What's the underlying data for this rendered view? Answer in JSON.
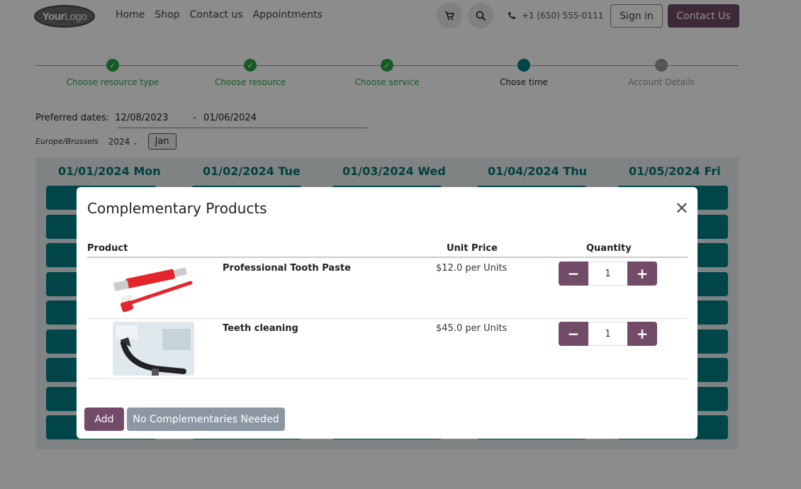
{
  "header": {
    "logo_text_bold": "Your",
    "logo_text": "Logo",
    "nav": [
      "Home",
      "Shop",
      "Contact us",
      "Appointments"
    ],
    "phone": "+1 (650) 555-0111",
    "signin": "Sign in",
    "contact": "Contact Us"
  },
  "steps": [
    {
      "label": "Choose resource type",
      "state": "done"
    },
    {
      "label": "Choose resource",
      "state": "done"
    },
    {
      "label": "Choose service",
      "state": "done"
    },
    {
      "label": "Chose time",
      "state": "current"
    },
    {
      "label": "Account Details",
      "state": "todo"
    }
  ],
  "preferred": {
    "label": "Preferred dates:",
    "start": "12/08/2023",
    "sep": "-",
    "end": "01/06/2024"
  },
  "timezone": "Europe/Brussels",
  "year": "2024",
  "month": "Jan",
  "calendar_days": [
    "01/01/2024 Mon",
    "01/02/2024 Tue",
    "01/03/2024 Wed",
    "01/04/2024 Thu",
    "01/05/2024 Fri"
  ],
  "modal": {
    "title": "Complementary Products",
    "col_product": "Product",
    "col_price": "Unit Price",
    "col_qty": "Quantity",
    "products": [
      {
        "name": "Professional Tooth Paste",
        "price": "$12.0 per Units",
        "qty": "1"
      },
      {
        "name": "Teeth cleaning",
        "price": "$45.0 per Units",
        "qty": "1"
      }
    ],
    "add_label": "Add",
    "none_label": "No Complementaries Needed"
  },
  "colors": {
    "primary": "#714B67",
    "teal": "#017e84",
    "done": "#28a745"
  }
}
